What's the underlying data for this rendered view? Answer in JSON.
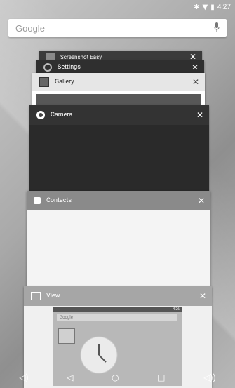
{
  "status_bar": {
    "time": "4:27"
  },
  "search": {
    "placeholder": "Google"
  },
  "recents": [
    {
      "name": "Screenshot Easy",
      "bg": "#3b3b3b"
    },
    {
      "name": "Settings",
      "bg": "#2f2f2f"
    },
    {
      "name": "Gallery",
      "bg": "#6b6b6b"
    },
    {
      "name": "Camera",
      "bg": "#222222"
    },
    {
      "name": "Contacts",
      "bg": "#8a8a8a"
    },
    {
      "name": "View",
      "bg": "#a6a6a6"
    }
  ],
  "view_preview": {
    "search_hint": "Google",
    "time": "4:26"
  },
  "nav": {
    "volume_down": "◁)",
    "back": "◁",
    "home": "○",
    "recents": "□",
    "volume_up": "◁))"
  }
}
